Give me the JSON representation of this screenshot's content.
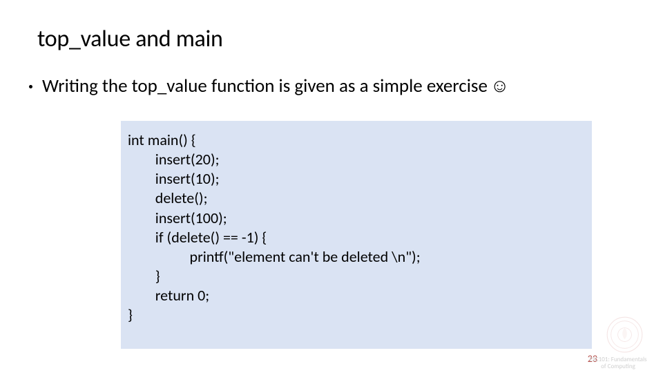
{
  "title": "top_value and main",
  "bullet": {
    "text": "Writing the top_value function is given as a simple exercise",
    "emoji": "☺"
  },
  "code": {
    "l0": "int main() {",
    "l1": "        insert(20);",
    "l2": "        insert(10);",
    "l3": "        delete();",
    "l4": "        insert(100);",
    "l5": "        if (delete() == -1) {",
    "l6": "                  printf(\"element can't be deleted \\n\");",
    "l7": "        }",
    "l8": "        return 0;",
    "l9": "}"
  },
  "page_number": "23",
  "footer": {
    "line1": "ESC101: Fundamentals",
    "line2": "of Computing"
  }
}
